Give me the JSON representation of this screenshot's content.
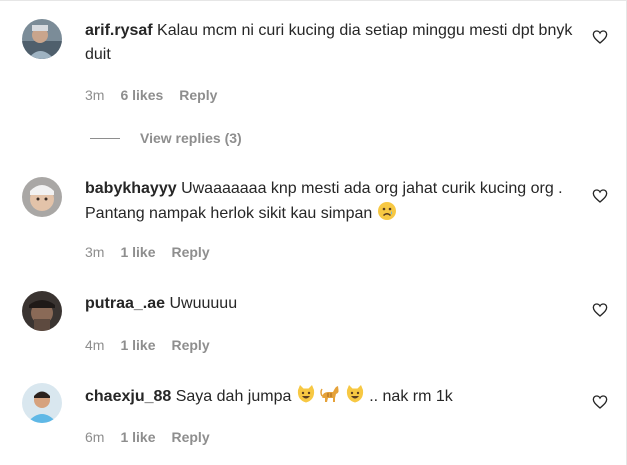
{
  "comments": [
    {
      "username": "arif.rysaf",
      "text": "Kalau mcm ni curi kucing dia setiap minggu mesti dpt bnyk duit",
      "time": "3m",
      "likes": "6 likes",
      "reply": "Reply",
      "view_replies": "View replies (3)"
    },
    {
      "username": "babykhayyy",
      "text": "Uwaaaaaaa knp mesti ada org jahat curik kucing org . Pantang nampak herlok sikit kau simpan",
      "emoji": "crying-face",
      "time": "3m",
      "likes": "1 like",
      "reply": "Reply"
    },
    {
      "username": "putraa_.ae",
      "text": "Uwuuuuu",
      "time": "4m",
      "likes": "1 like",
      "reply": "Reply"
    },
    {
      "username": "chaexju_88",
      "text_before": "Saya dah jumpa",
      "emojis": [
        "smiling-cat-face",
        "cat",
        "smiling-cat-face"
      ],
      "text_after": ".. nak rm 1k",
      "time": "6m",
      "likes": "1 like",
      "reply": "Reply"
    }
  ],
  "icons": {
    "like": "heart-outline-icon"
  },
  "colors": {
    "text": "#262626",
    "secondary": "#8e8e8e",
    "emoji_yellow": "#f7c843"
  }
}
